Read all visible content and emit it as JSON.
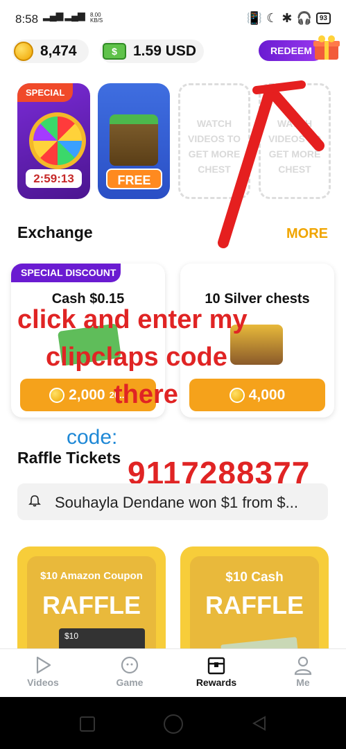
{
  "status": {
    "time": "8:58",
    "net_speed": "8.00\nKB/S",
    "battery": "93"
  },
  "balance": {
    "coins": "8,474",
    "usd": "1.59 USD",
    "cash_symbol": "$"
  },
  "redeem_label": "REDEEM",
  "featured": {
    "special_tag": "SPECIAL",
    "timer": "2:59:13",
    "free_label": "FREE",
    "placeholder_1": "WATCH\nVIDEOS TO\nGET MORE\nCHEST",
    "placeholder_2": "WATCH\nVIDEOS TO\nGET MORE\nCHEST"
  },
  "exchange": {
    "title": "Exchange",
    "more": "MORE",
    "items": [
      {
        "tag": "SPECIAL DISCOUNT",
        "title": "Cash $0.15",
        "price": "2,000",
        "old_price": "20..."
      },
      {
        "title": "10 Silver chests",
        "price": "4,000"
      }
    ]
  },
  "overlay": {
    "line1": "click and enter my",
    "line2": "clipclaps code",
    "line3": "there",
    "code_label": "code:",
    "code_value": "9117288377"
  },
  "raffle": {
    "title": "Raffle Tickets",
    "ticker": "Souhayla Dendane won $1 from $...",
    "cards": [
      {
        "subtitle": "$10 Amazon Coupon",
        "label": "RAFFLE",
        "denomination": "$10"
      },
      {
        "subtitle": "$10 Cash",
        "label": "RAFFLE"
      }
    ]
  },
  "nav": [
    {
      "label": "Videos",
      "active": false
    },
    {
      "label": "Game",
      "active": false
    },
    {
      "label": "Rewards",
      "active": true
    },
    {
      "label": "Me",
      "active": false
    }
  ],
  "colors": {
    "accent_purple": "#6a1bd1",
    "accent_orange": "#f5a21b",
    "overlay_red": "#e02424",
    "code_blue": "#1e88d6"
  }
}
